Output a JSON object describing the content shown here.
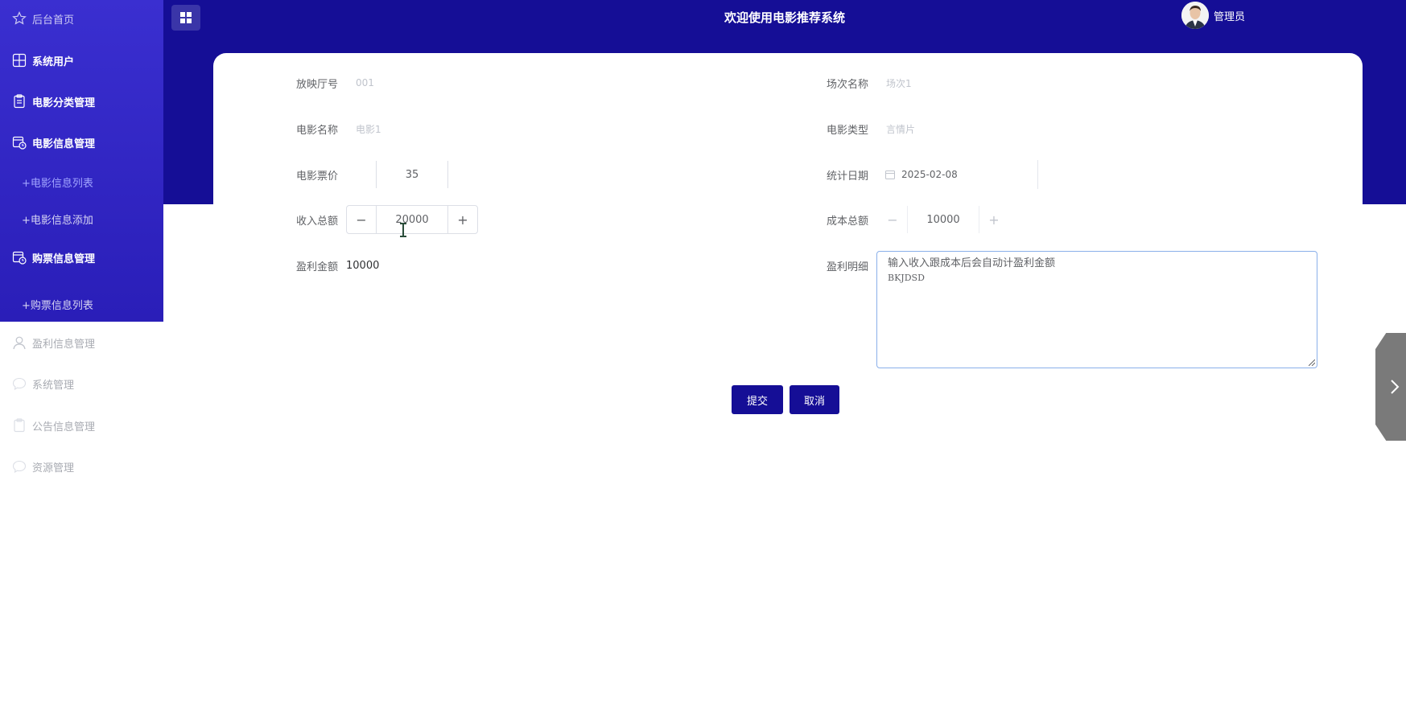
{
  "header": {
    "title": "欢迎使用电影推荐系统",
    "username": "管理员"
  },
  "sidebar": {
    "items": [
      {
        "label": "后台首页",
        "icon": "star-icon"
      },
      {
        "label": "系统用户",
        "icon": "grid-icon"
      },
      {
        "label": "电影分类管理",
        "icon": "clipboard-icon"
      },
      {
        "label": "电影信息管理",
        "icon": "calendar-clock-icon"
      },
      {
        "label": "+电影信息列表",
        "icon": ""
      },
      {
        "label": "+电影信息添加",
        "icon": ""
      },
      {
        "label": "购票信息管理",
        "icon": "calendar-clock-icon"
      },
      {
        "label": "+购票信息列表",
        "icon": ""
      },
      {
        "label": "盈利信息管理",
        "icon": "user-icon"
      },
      {
        "label": "系统管理",
        "icon": "chat-icon"
      },
      {
        "label": "公告信息管理",
        "icon": "clipboard-icon"
      },
      {
        "label": "资源管理",
        "icon": "chat-icon"
      }
    ]
  },
  "form": {
    "hall": {
      "label": "放映厅号",
      "value": "001"
    },
    "session": {
      "label": "场次名称",
      "value": "场次1"
    },
    "movie_name": {
      "label": "电影名称",
      "value": "电影1"
    },
    "movie_type": {
      "label": "电影类型",
      "value": "言情片"
    },
    "price": {
      "label": "电影票价",
      "value": "35"
    },
    "stat_date": {
      "label": "统计日期",
      "value": "2025-02-08"
    },
    "income": {
      "label": "收入总额",
      "value": "20000"
    },
    "cost": {
      "label": "成本总额",
      "value": "10000"
    },
    "profit": {
      "label": "盈利金额",
      "value": "10000"
    },
    "profit_detail": {
      "label": "盈利明细",
      "line1": "输入收入跟成本后会自动计盈利金额",
      "line2": "BKJDSD"
    },
    "submit_label": "提交",
    "cancel_label": "取消"
  },
  "colors": {
    "primary": "#150e96",
    "sidebar": "#3a2fd0",
    "active": "#a1a4ff"
  }
}
